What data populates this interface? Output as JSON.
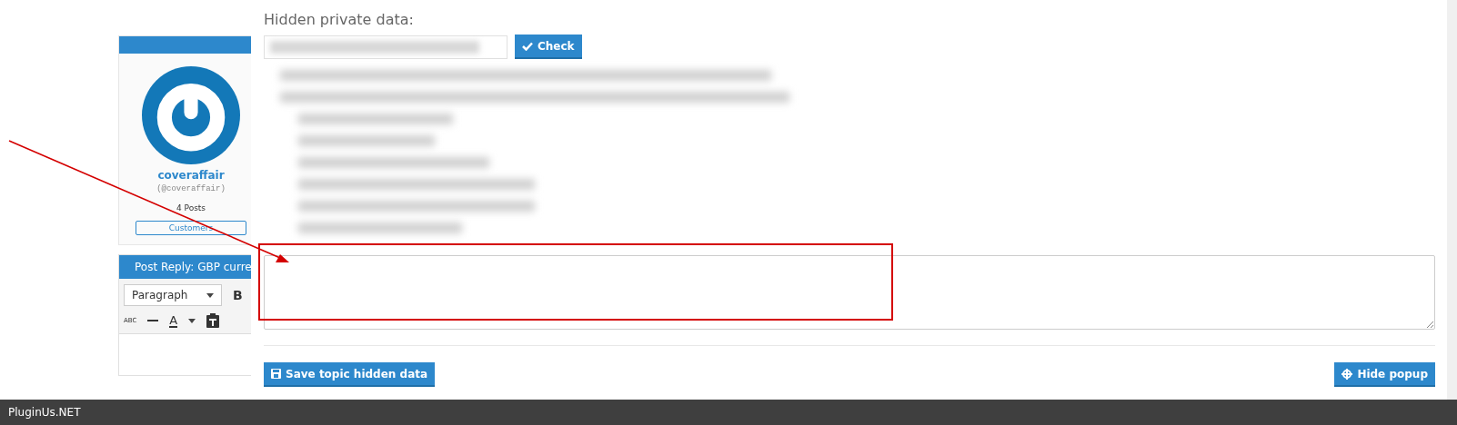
{
  "profile": {
    "username": "coveraffair",
    "handle": "(@coveraffair)",
    "posts": "4 Posts",
    "group": "Customers"
  },
  "reply_panel": {
    "title": "Post Reply: GBP curre",
    "format_select": "Paragraph",
    "bold_button": "B",
    "strikethrough_button": "ABC",
    "text_color_button": "A"
  },
  "popup": {
    "title": "Hidden private data:",
    "check_button": "Check",
    "save_button": "Save topic hidden data",
    "hide_button": "Hide popup"
  },
  "footer": {
    "brand": "PluginUs.NET"
  }
}
